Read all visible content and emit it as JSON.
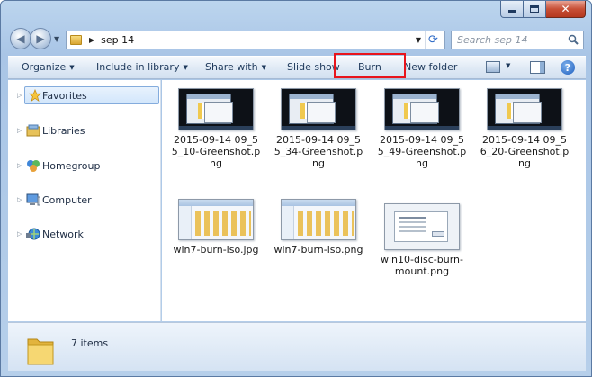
{
  "window": {
    "address": {
      "path_segment": "sep 14"
    },
    "search": {
      "placeholder": "Search sep 14"
    }
  },
  "toolbar": {
    "organize": "Organize",
    "include_in_library": "Include in library",
    "share_with": "Share with",
    "slide_show": "Slide show",
    "burn": "Burn",
    "new_folder": "New folder"
  },
  "navpane": {
    "items": [
      {
        "label": "Favorites",
        "icon": "star-icon"
      },
      {
        "label": "Libraries",
        "icon": "libraries-icon"
      },
      {
        "label": "Homegroup",
        "icon": "homegroup-icon"
      },
      {
        "label": "Computer",
        "icon": "computer-icon"
      },
      {
        "label": "Network",
        "icon": "network-icon"
      }
    ]
  },
  "files": [
    {
      "name": "2015-09-14 09_55_10-Greenshot.png",
      "thumb": "dark"
    },
    {
      "name": "2015-09-14 09_55_34-Greenshot.png",
      "thumb": "dark"
    },
    {
      "name": "2015-09-14 09_55_49-Greenshot.png",
      "thumb": "dark"
    },
    {
      "name": "2015-09-14 09_56_20-Greenshot.png",
      "thumb": "dark"
    },
    {
      "name": "win7-burn-iso.jpg",
      "thumb": "light"
    },
    {
      "name": "win7-burn-iso.png",
      "thumb": "light"
    },
    {
      "name": "win10-disc-burn-mount.png",
      "thumb": "mount"
    }
  ],
  "details": {
    "item_count": "7 items"
  },
  "colors": {
    "highlight_box": "#e8141c",
    "selection": "#d2e6fb"
  }
}
